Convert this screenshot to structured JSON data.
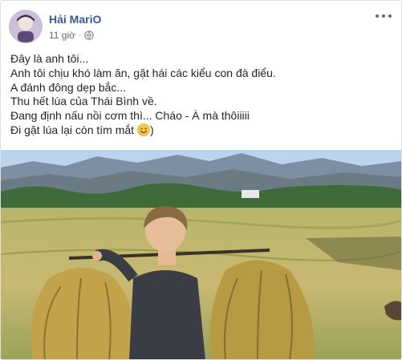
{
  "post": {
    "author": "Hải MariO",
    "time": "11 giờ",
    "separator": "·",
    "privacy_icon": "globe-icon",
    "more_icon": "ellipsis-icon",
    "lines": [
      "Đây là anh tôi...",
      "Anh tôi chịu khó làm ăn, gặt hái các kiểu con đà điểu.",
      "A đánh đông dẹp bắc...",
      "Thu hết lúa của Thái Bình về.",
      "Đang định nấu nồi cơm thì... Cháo - À mà thôiiiii",
      "Đi gặt lúa lại còn tím mắt"
    ],
    "last_line_suffix": ")",
    "emoji": "smile-emoji"
  },
  "colors": {
    "author": "#385898",
    "text": "#1d2129",
    "meta": "#616770"
  }
}
